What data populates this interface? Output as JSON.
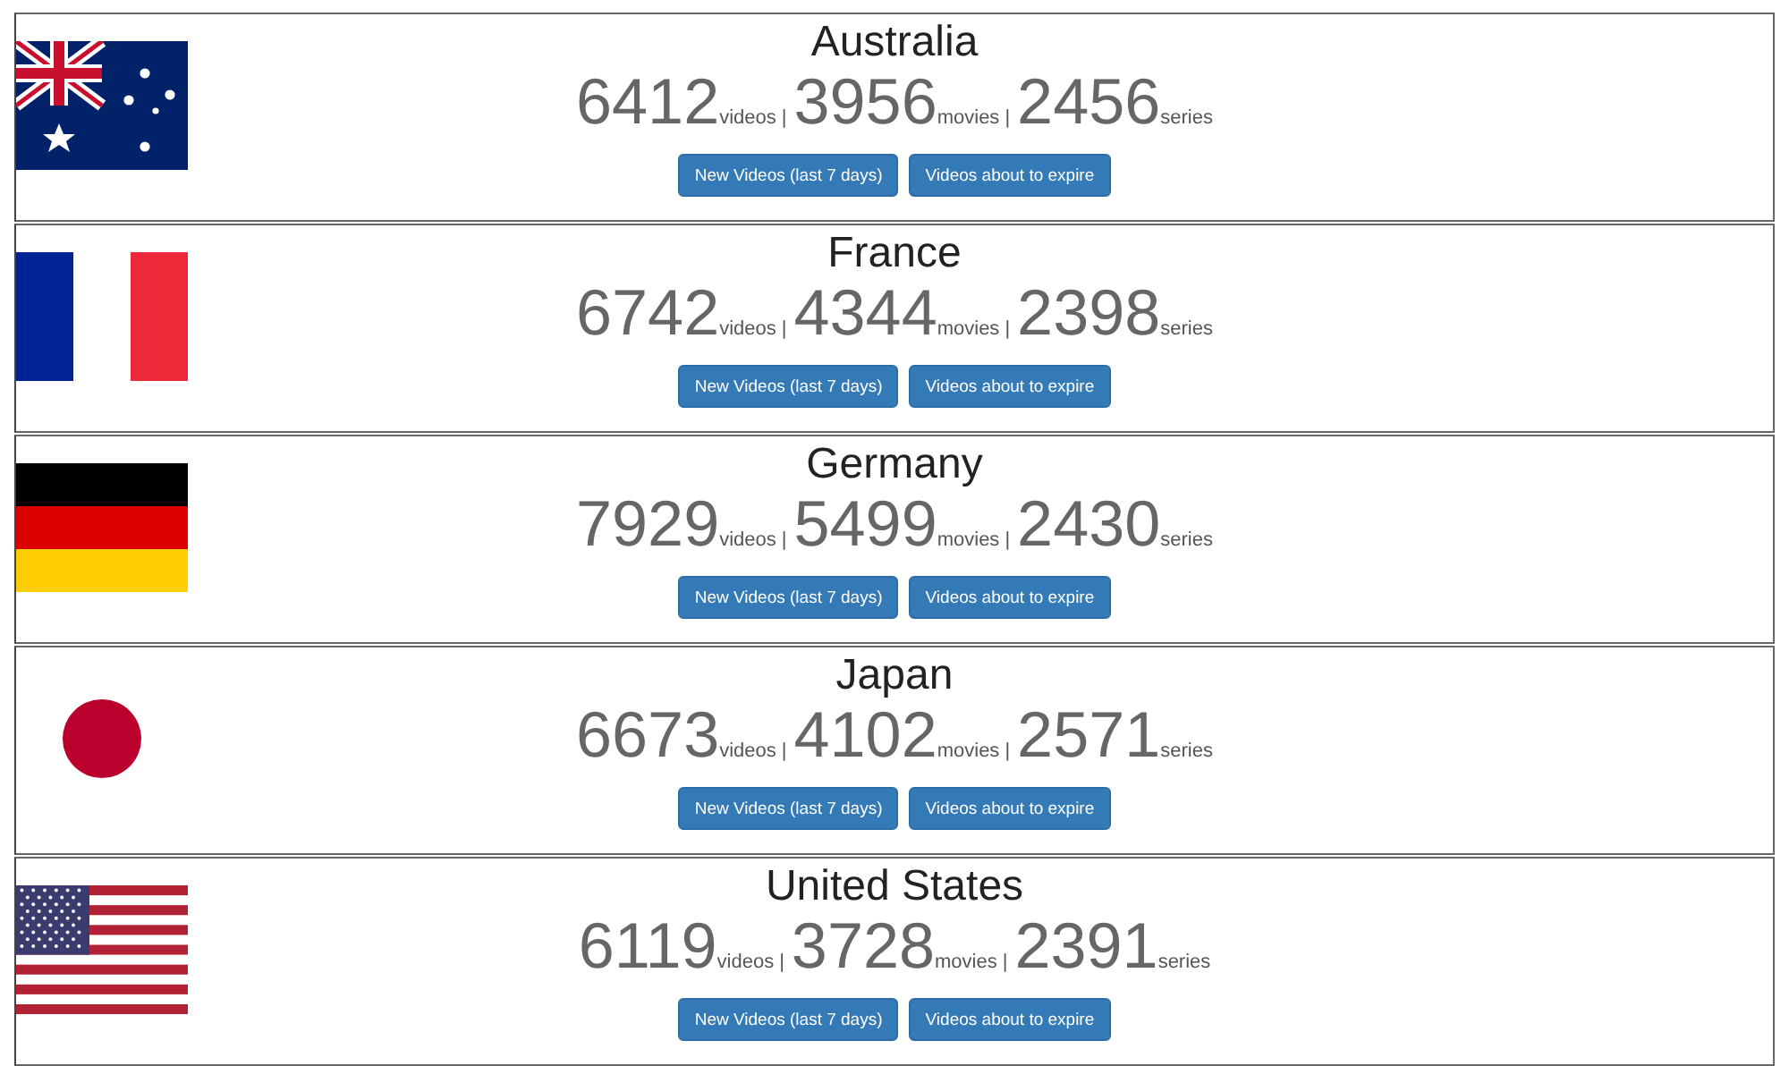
{
  "countries": [
    {
      "kind": "au",
      "name": "Australia",
      "stats": [
        {
          "count": "6412",
          "label": "videos",
          "separator": "|"
        },
        {
          "count": "3956",
          "label": "movies",
          "separator": "|"
        },
        {
          "count": "2456",
          "label": "series"
        }
      ],
      "buttons": [
        "New Videos (last 7 days)",
        "Videos about to expire"
      ]
    },
    {
      "kind": "fr",
      "name": "France",
      "stats": [
        {
          "count": "6742",
          "label": "videos",
          "separator": "|"
        },
        {
          "count": "4344",
          "label": "movies",
          "separator": "|"
        },
        {
          "count": "2398",
          "label": "series"
        }
      ],
      "buttons": [
        "New Videos (last 7 days)",
        "Videos about to expire"
      ]
    },
    {
      "kind": "de",
      "name": "Germany",
      "stats": [
        {
          "count": "7929",
          "label": "videos",
          "separator": "|"
        },
        {
          "count": "5499",
          "label": "movies",
          "separator": "|"
        },
        {
          "count": "2430",
          "label": "series"
        }
      ],
      "buttons": [
        "New Videos (last 7 days)",
        "Videos about to expire"
      ]
    },
    {
      "kind": "jp",
      "name": "Japan",
      "stats": [
        {
          "count": "6673",
          "label": "videos",
          "separator": "|"
        },
        {
          "count": "4102",
          "label": "movies",
          "separator": "|"
        },
        {
          "count": "2571",
          "label": "series"
        }
      ],
      "buttons": [
        "New Videos (last 7 days)",
        "Videos about to expire"
      ]
    },
    {
      "kind": "us",
      "name": "United States",
      "stats": [
        {
          "count": "6119",
          "label": "videos",
          "separator": "|"
        },
        {
          "count": "3728",
          "label": "movies",
          "separator": "|"
        },
        {
          "count": "2391",
          "label": "series"
        }
      ],
      "buttons": [
        "New Videos (last 7 days)",
        "Videos about to expire"
      ]
    }
  ]
}
